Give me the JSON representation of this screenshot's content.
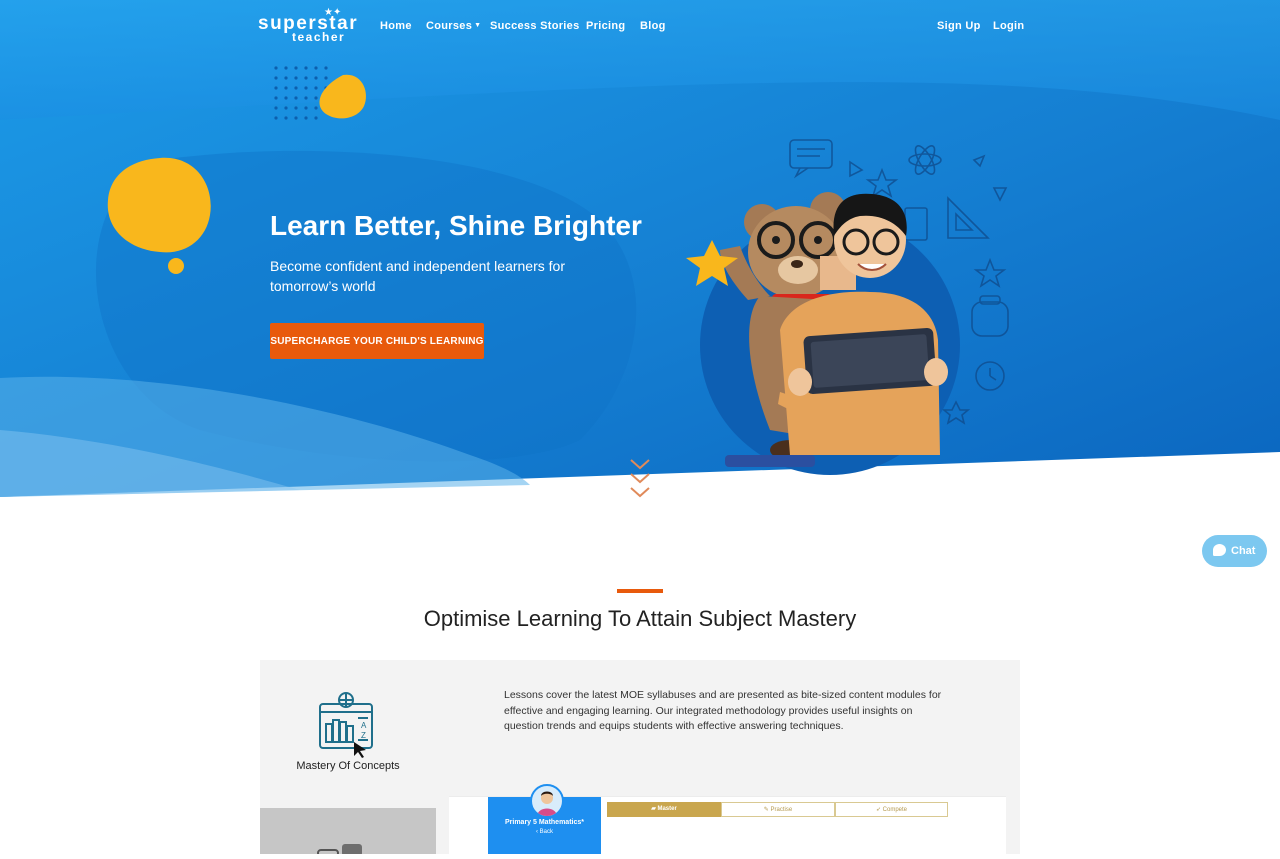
{
  "brand": {
    "line1": "superstar",
    "line2": "teacher"
  },
  "nav": {
    "items": [
      {
        "label": "Home"
      },
      {
        "label": "Courses"
      },
      {
        "label": "Success Stories"
      },
      {
        "label": "Pricing"
      },
      {
        "label": "Blog"
      }
    ],
    "auth": [
      {
        "label": "Sign Up"
      },
      {
        "label": "Login"
      }
    ]
  },
  "hero": {
    "title": "Learn Better, Shine Brighter",
    "subtitle": "Become confident and independent learners for tomorrow’s world",
    "cta": "SUPERCHARGE YOUR CHILD'S LEARNING"
  },
  "chat": {
    "label": "Chat"
  },
  "mastery": {
    "title": "Optimise Learning To Attain Subject Mastery",
    "tab_label": "Mastery Of Concepts",
    "description": "Lessons cover the latest MOE syllabuses and are presented as bite-sized content modules for effective and engaging learning. Our integrated methodology provides useful insights on question trends and equips students with effective answering techniques.",
    "preview": {
      "course_title": "Primary 5 Mathematics*",
      "back_label": "Back",
      "tabs": [
        {
          "label": "Master"
        },
        {
          "label": "Practise"
        },
        {
          "label": "Compete"
        }
      ]
    }
  },
  "colors": {
    "hero_blue": "#1a8fe0",
    "accent_orange": "#e85a0c",
    "accent_yellow": "#f9b71c",
    "chat_blue": "#7cc8f0",
    "tab_gold": "#c9a64e"
  }
}
